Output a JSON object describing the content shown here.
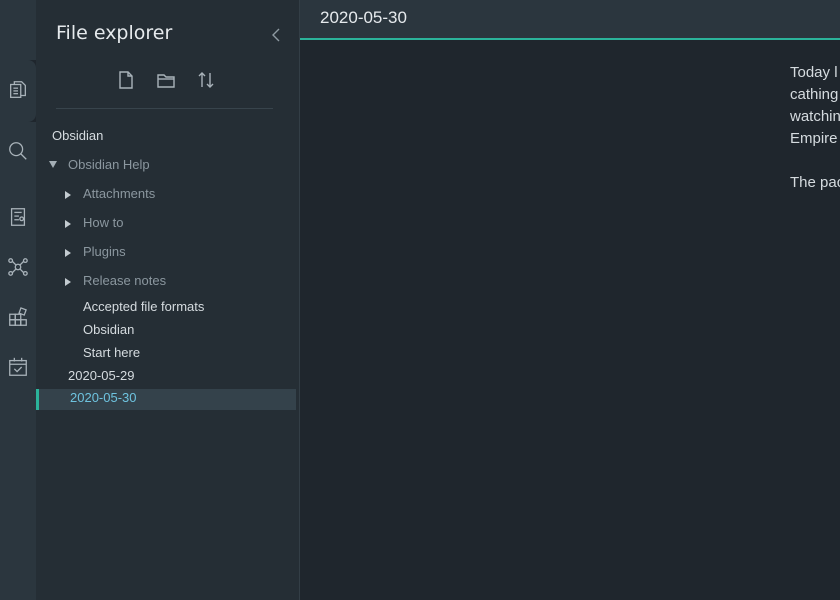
{
  "ribbon": {
    "icons": [
      "files-icon",
      "search-icon",
      "backlinks-icon",
      "graph-icon",
      "plugins-icon",
      "calendar-icon"
    ]
  },
  "sidebar": {
    "title": "File explorer",
    "toolbar": {
      "new_note": "new-note-icon",
      "new_folder": "new-folder-icon",
      "sort": "sort-icon"
    },
    "tree": {
      "vault": "Obsidian",
      "folder_open": "Obsidian Help",
      "subfolders": [
        "Attachments",
        "How to",
        "Plugins",
        "Release notes"
      ],
      "files": [
        "Accepted file formats",
        "Obsidian",
        "Start here"
      ],
      "root_files": [
        "2020-05-29",
        "2020-05-30"
      ]
    }
  },
  "main": {
    "title": "2020-05-30",
    "content_lines": [
      "Today l",
      "cathing",
      "watchin",
      "Empire",
      "The pac"
    ]
  },
  "colors": {
    "accent": "#2bb39a",
    "selected_text": "#6ec3df"
  }
}
